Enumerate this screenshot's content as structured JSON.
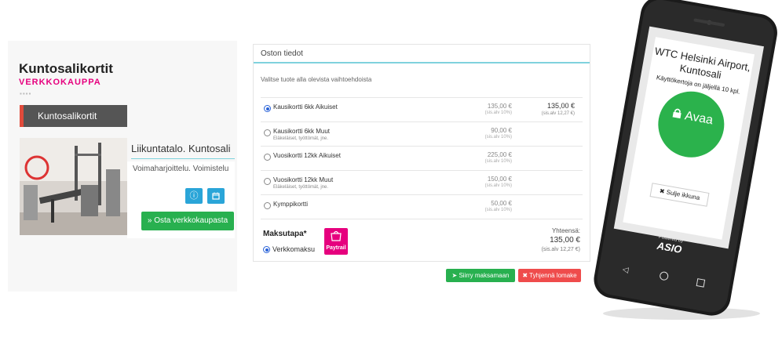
{
  "left_panel": {
    "title": "Kuntosalikortit",
    "subtitle": "VERKKOKAUPPA",
    "dots": "▪▪▪▪",
    "category_tab": "Kuntosalikortit",
    "venue_name": "Liikuntatalo. Kuntosali",
    "venue_tags": "Voimaharjoittelu. Voimistelu",
    "info_icon": "info-icon",
    "calendar_icon": "calendar-icon",
    "buy_button": "» Osta verkkokaupasta"
  },
  "purchase": {
    "header": "Oston tiedot",
    "intro": "Valitse tuote alla olevista vaihtoehdoista",
    "products": [
      {
        "name": "Kausikortti 6kk Aikuiset",
        "note": "",
        "price": "135,00 €",
        "vat": "(sis.alv 10%)",
        "total": "135,00 €",
        "total_vat": "(sis.alv 12,27 €)",
        "selected": true
      },
      {
        "name": "Kausikortti 6kk Muut",
        "note": "Eläkeläiset, työttömät, jne.",
        "price": "90,00 €",
        "vat": "(sis.alv 10%)",
        "total": "",
        "total_vat": "",
        "selected": false
      },
      {
        "name": "Vuosikortti 12kk Aikuiset",
        "note": "",
        "price": "225,00 €",
        "vat": "(sis.alv 10%)",
        "total": "",
        "total_vat": "",
        "selected": false
      },
      {
        "name": "Vuosikortti 12kk Muut",
        "note": "Eläkeläiset, työttömät, jne.",
        "price": "150,00 €",
        "vat": "(sis.alv 10%)",
        "total": "",
        "total_vat": "",
        "selected": false
      },
      {
        "name": "Kymppikortti",
        "note": "",
        "price": "50,00 €",
        "vat": "(sis.alv 10%)",
        "total": "",
        "total_vat": "",
        "selected": false
      }
    ],
    "payment_title": "Maksutapa*",
    "payment_option": "Verkkomaksu",
    "paytrail_label": "Paytrail",
    "total_label": "Yhteensä:",
    "total_value": "135,00 €",
    "total_vat": "(sis.alv 12,27 €)",
    "proceed_button": "Siirry maksamaan",
    "clear_button": "Tyhjennä lomake"
  },
  "phone": {
    "location": "WTC Helsinki Airport,",
    "location2": "Kuntosali",
    "uses_left": "Käyttökertoja on jäljellä 10 kpl.",
    "open_button": "Avaa",
    "close_button": "Sulje ikkuna",
    "powered_by": "Powered by",
    "brand": "ASIO",
    "nav_back_icon": "back-icon",
    "nav_home_icon": "home-icon",
    "nav_recent_icon": "recent-apps-icon"
  },
  "colors": {
    "accent_pink": "#e6007e",
    "green": "#28b04f",
    "red": "#ef4c4c",
    "blue": "#2aa5d8",
    "teal_line": "#7fd2dd"
  }
}
